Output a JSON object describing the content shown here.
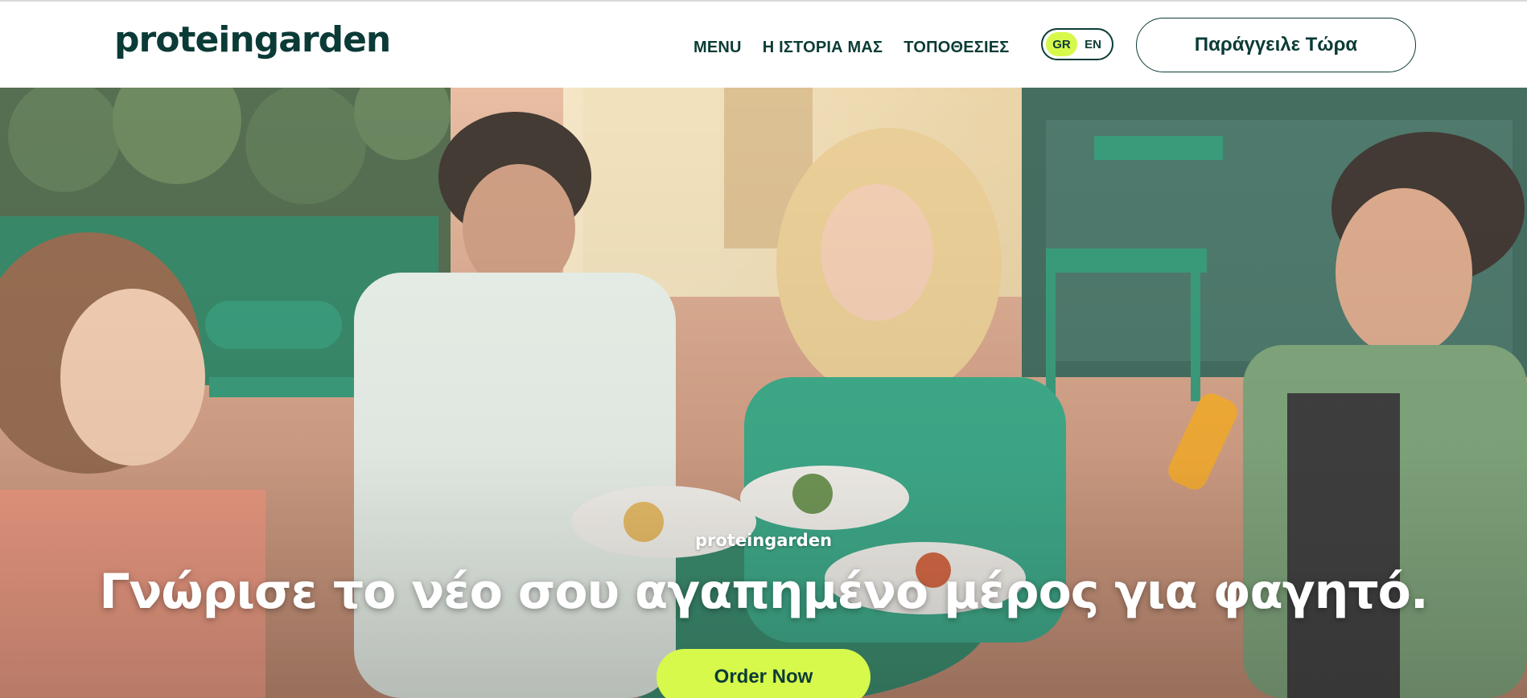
{
  "header": {
    "logo_text": "proteingarden",
    "nav": [
      {
        "label": "MENU"
      },
      {
        "label": "Η ΙΣΤΟΡΙΑ ΜΑΣ"
      },
      {
        "label": "ΤΟΠΟΘΕΣΙΕΣ"
      }
    ],
    "language": {
      "options": [
        "GR",
        "EN"
      ],
      "selected": "GR"
    },
    "order_button": "Παράγγειλε Τώρα"
  },
  "hero": {
    "brand_text": "proteingarden",
    "headline": "Γνώρισε το νέο σου αγαπημένο μέρος για φαγητό.",
    "cta_label": "Order Now",
    "image_icon": "photo-diners-at-cafe-table"
  },
  "colors": {
    "brand_dark": "#0b3b36",
    "accent_lime": "#d7f94b",
    "furniture_green": "#1f8f6a"
  }
}
